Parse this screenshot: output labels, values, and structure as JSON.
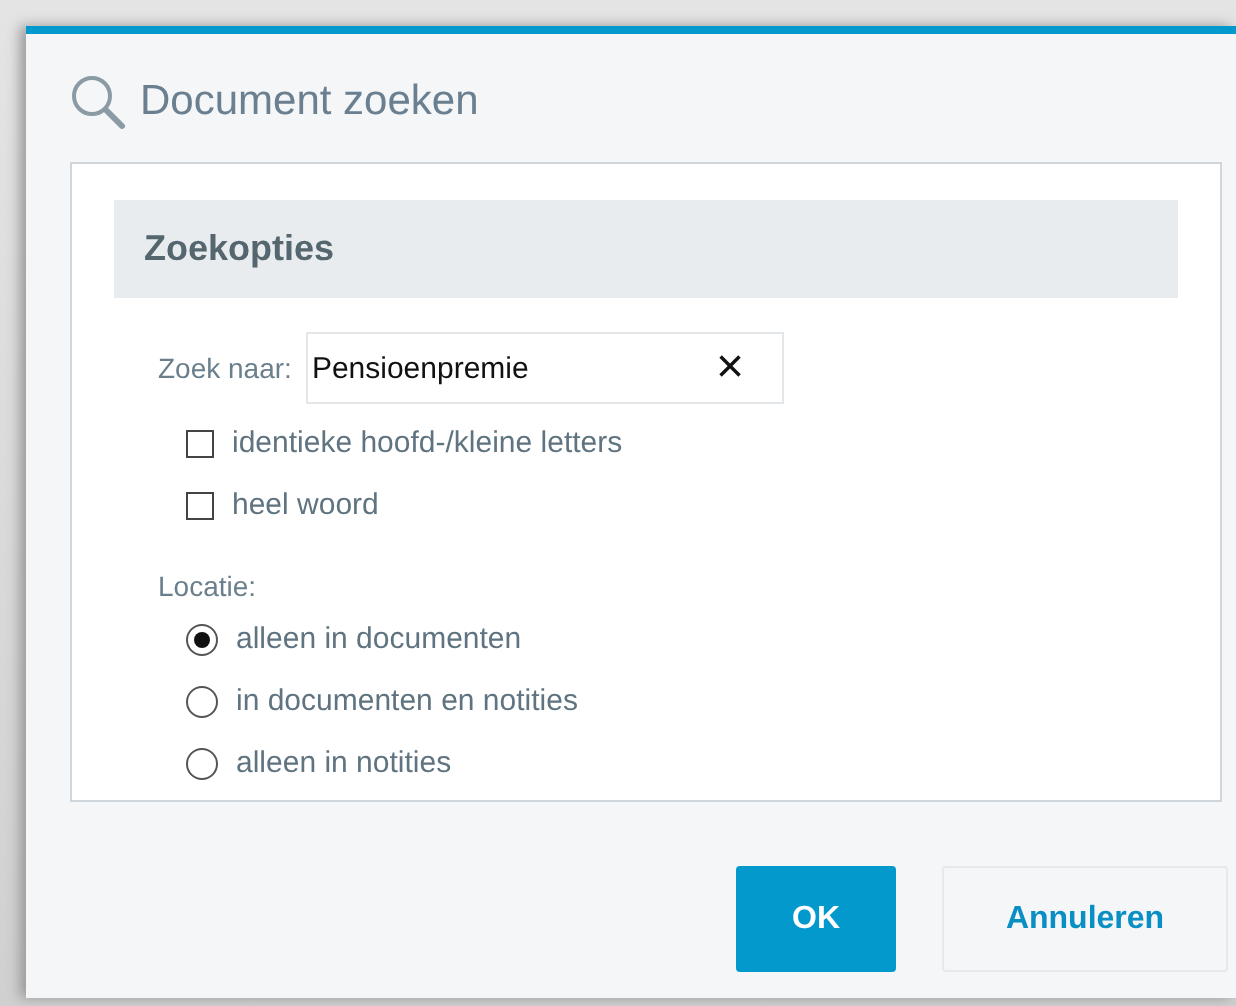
{
  "dialog": {
    "title": "Document zoeken"
  },
  "section": {
    "title": "Zoekopties"
  },
  "search": {
    "label": "Zoek naar:",
    "value": "Pensioenpremie",
    "clear": "×"
  },
  "options": [
    {
      "label": "identieke hoofd-/kleine letters",
      "checked": false
    },
    {
      "label": "heel woord",
      "checked": false
    }
  ],
  "location": {
    "label": "Locatie:",
    "choices": [
      {
        "label": "alleen in documenten",
        "selected": true
      },
      {
        "label": "in documenten en notities",
        "selected": false
      },
      {
        "label": "alleen in notities",
        "selected": false
      }
    ]
  },
  "buttons": [
    {
      "label": "OK",
      "kind": "primary"
    },
    {
      "label": "Annuleren",
      "kind": "secondary"
    }
  ]
}
